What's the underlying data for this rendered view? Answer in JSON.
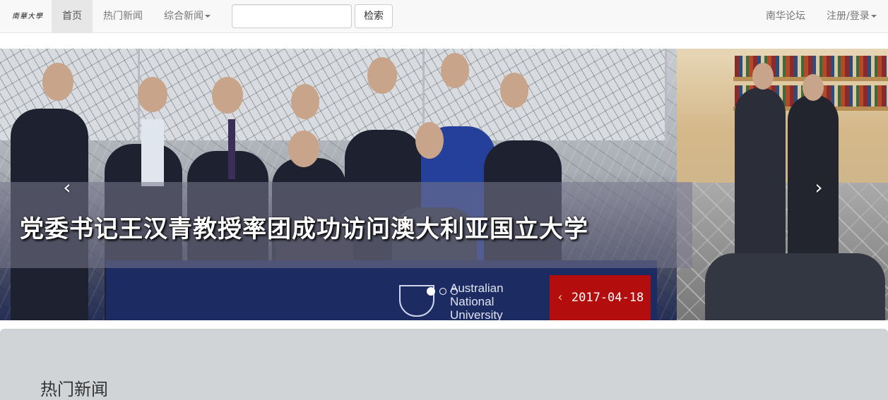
{
  "navbar": {
    "brand": "南華大學",
    "items": [
      {
        "label": "首页",
        "active": true
      },
      {
        "label": "热门新闻"
      },
      {
        "label": "综合新闻",
        "dropdown": true
      }
    ],
    "search": {
      "placeholder": "",
      "value": "",
      "button_label": "检索"
    },
    "right_items": [
      {
        "label": "南华论坛"
      },
      {
        "label": "注册/登录",
        "dropdown": true
      }
    ]
  },
  "carousel": {
    "caption": "党委书记王汉青教授率团成功访问澳大利亚国立大学",
    "date": "2017-04-18",
    "prev_icon": "‹",
    "next_icon": "›",
    "indicator_count": 3,
    "active_indicator": 0,
    "photo_text": [
      "Australian",
      "National",
      "University"
    ]
  },
  "content": {
    "section_title": "热门新闻"
  },
  "colors": {
    "accent": "#b30d0d",
    "nav_bg": "#f8f8f8",
    "content_bg": "#d1d4d6"
  }
}
